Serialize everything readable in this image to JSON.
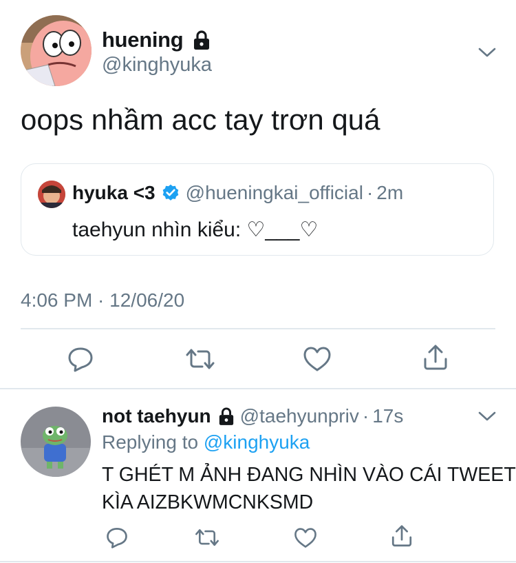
{
  "main_tweet": {
    "author": {
      "display_name": "huening",
      "handle": "@kinghyuka",
      "locked": true,
      "avatar_icon": "patrick-star-avatar"
    },
    "text": "oops nhầm acc tay trơn quá",
    "quoted": {
      "display_name": "hyuka <3",
      "verified": true,
      "handle": "@hueningkai_official",
      "separator": "·",
      "time": "2m",
      "text": "taehyun nhìn kiểu: ♡___♡"
    },
    "timestamp": "4:06 PM · 12/06/20",
    "actions": [
      "reply-icon",
      "retweet-icon",
      "like-icon",
      "share-icon"
    ]
  },
  "reply_tweet": {
    "author": {
      "display_name": "not taehyun",
      "handle": "@taehyunpriv",
      "locked": true,
      "avatar_icon": "pepe-frog-avatar"
    },
    "separator": "·",
    "time": "17s",
    "replying_prefix": "Replying to",
    "replying_handle": "@kinghyuka",
    "text_line1": "T GHÉT M ẢNH ĐANG NHÌN VÀO CÁI TWEET",
    "text_line2": "KÌA AIZBKWMCNKSMD",
    "actions": [
      "reply-icon",
      "retweet-icon",
      "like-icon",
      "share-icon"
    ]
  },
  "colors": {
    "text": "#14171a",
    "secondary": "#657786",
    "accent": "#1da1f2",
    "border": "#e1e8ed"
  }
}
